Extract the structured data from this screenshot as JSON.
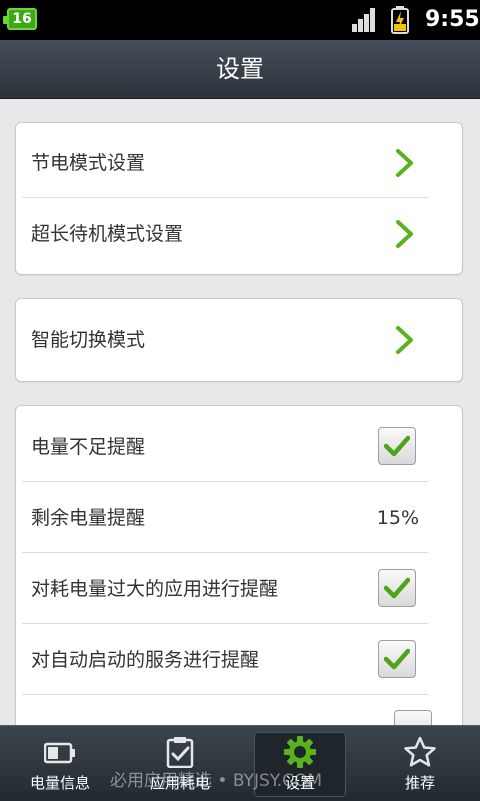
{
  "status_bar": {
    "battery_level": "16",
    "time": "9:55",
    "signal_icon": "signal-bars-icon",
    "charging_icon": "battery-charging-icon"
  },
  "header": {
    "title": "设置"
  },
  "groups": [
    {
      "items": [
        {
          "label": "节电模式设置",
          "control": "chevron"
        },
        {
          "label": "超长待机模式设置",
          "control": "chevron"
        }
      ]
    },
    {
      "items": [
        {
          "label": "智能切换模式",
          "control": "chevron"
        }
      ]
    },
    {
      "items": [
        {
          "label": "电量不足提醒",
          "control": "checkbox",
          "checked": true
        },
        {
          "label": "剩余电量提醒",
          "control": "value",
          "value": "15%"
        },
        {
          "label": "对耗电量过大的应用进行提醒",
          "control": "checkbox",
          "checked": true
        },
        {
          "label": "对自动启动的服务进行提醒",
          "control": "checkbox",
          "checked": true
        }
      ]
    }
  ],
  "bottom_nav": {
    "items": [
      {
        "label": "电量信息",
        "icon": "battery-icon",
        "active": false
      },
      {
        "label": "应用耗电",
        "icon": "clipboard-check-icon",
        "active": false
      },
      {
        "label": "设置",
        "icon": "gear-icon",
        "active": true
      },
      {
        "label": "推荐",
        "icon": "star-icon",
        "active": false
      }
    ]
  },
  "watermark": "必用应用精选 • BYJSY.COM",
  "colors": {
    "accent_green": "#5ab21f",
    "header_bg": "#2f3840",
    "nav_bg": "#2a323a"
  }
}
